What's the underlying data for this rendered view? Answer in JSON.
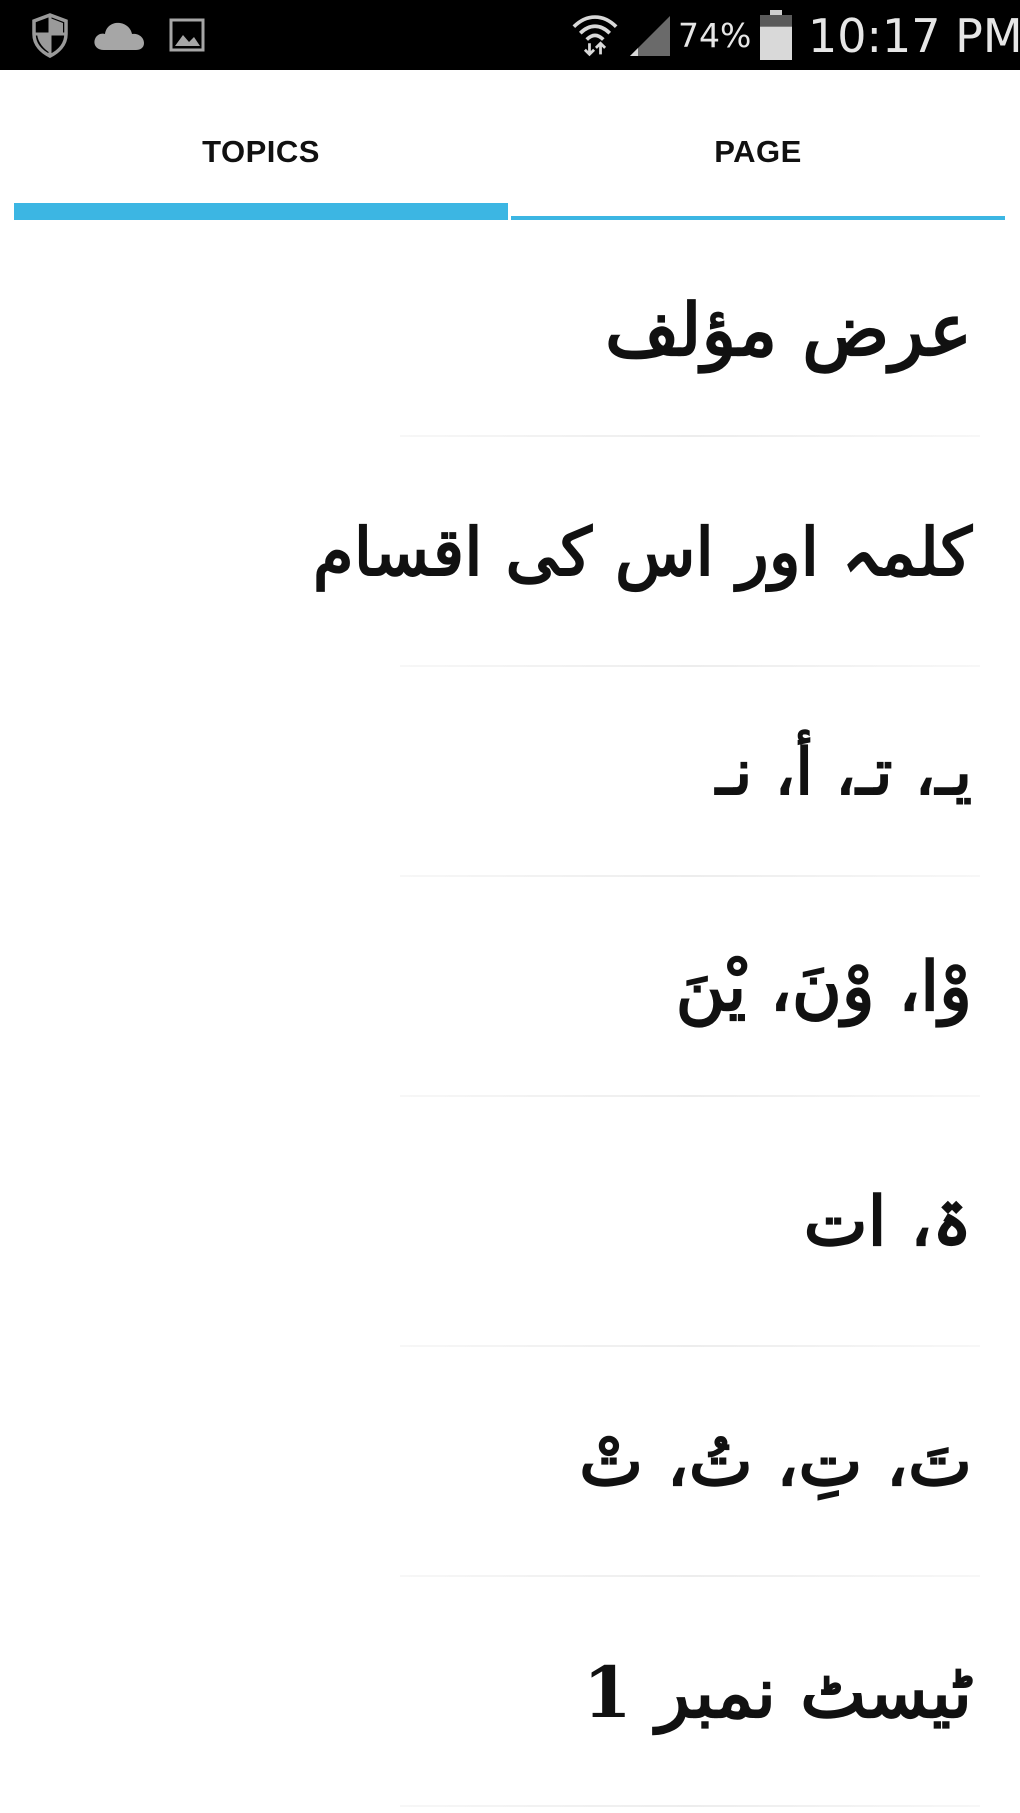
{
  "status_bar": {
    "icons_left": [
      "shield-icon",
      "cloud-icon",
      "image-icon"
    ],
    "icons_right": [
      "wifi-data-icon",
      "cell-signal-icon",
      "battery-icon"
    ],
    "battery_percent": "74%",
    "battery_level": 0.74,
    "time": "10:17 PM"
  },
  "tabs": [
    {
      "label": "TOPICS",
      "active": true
    },
    {
      "label": "PAGE",
      "active": false
    }
  ],
  "colors": {
    "accent": "#3cb6e3",
    "status_bar_bg": "#000000",
    "text": "#111111"
  },
  "topics": [
    {
      "label": "عرض مؤلف"
    },
    {
      "label": "کلمہ اور اس کی اقسام"
    },
    {
      "label": "یـ، تـ، أ، نـ"
    },
    {
      "label": "وْا، وْنَ، یْنَ"
    },
    {
      "label": "ۃ، ات"
    },
    {
      "label": "تَ، تِ، تُ، تْ"
    },
    {
      "label": "ٹیسٹ نمبر 1"
    }
  ]
}
